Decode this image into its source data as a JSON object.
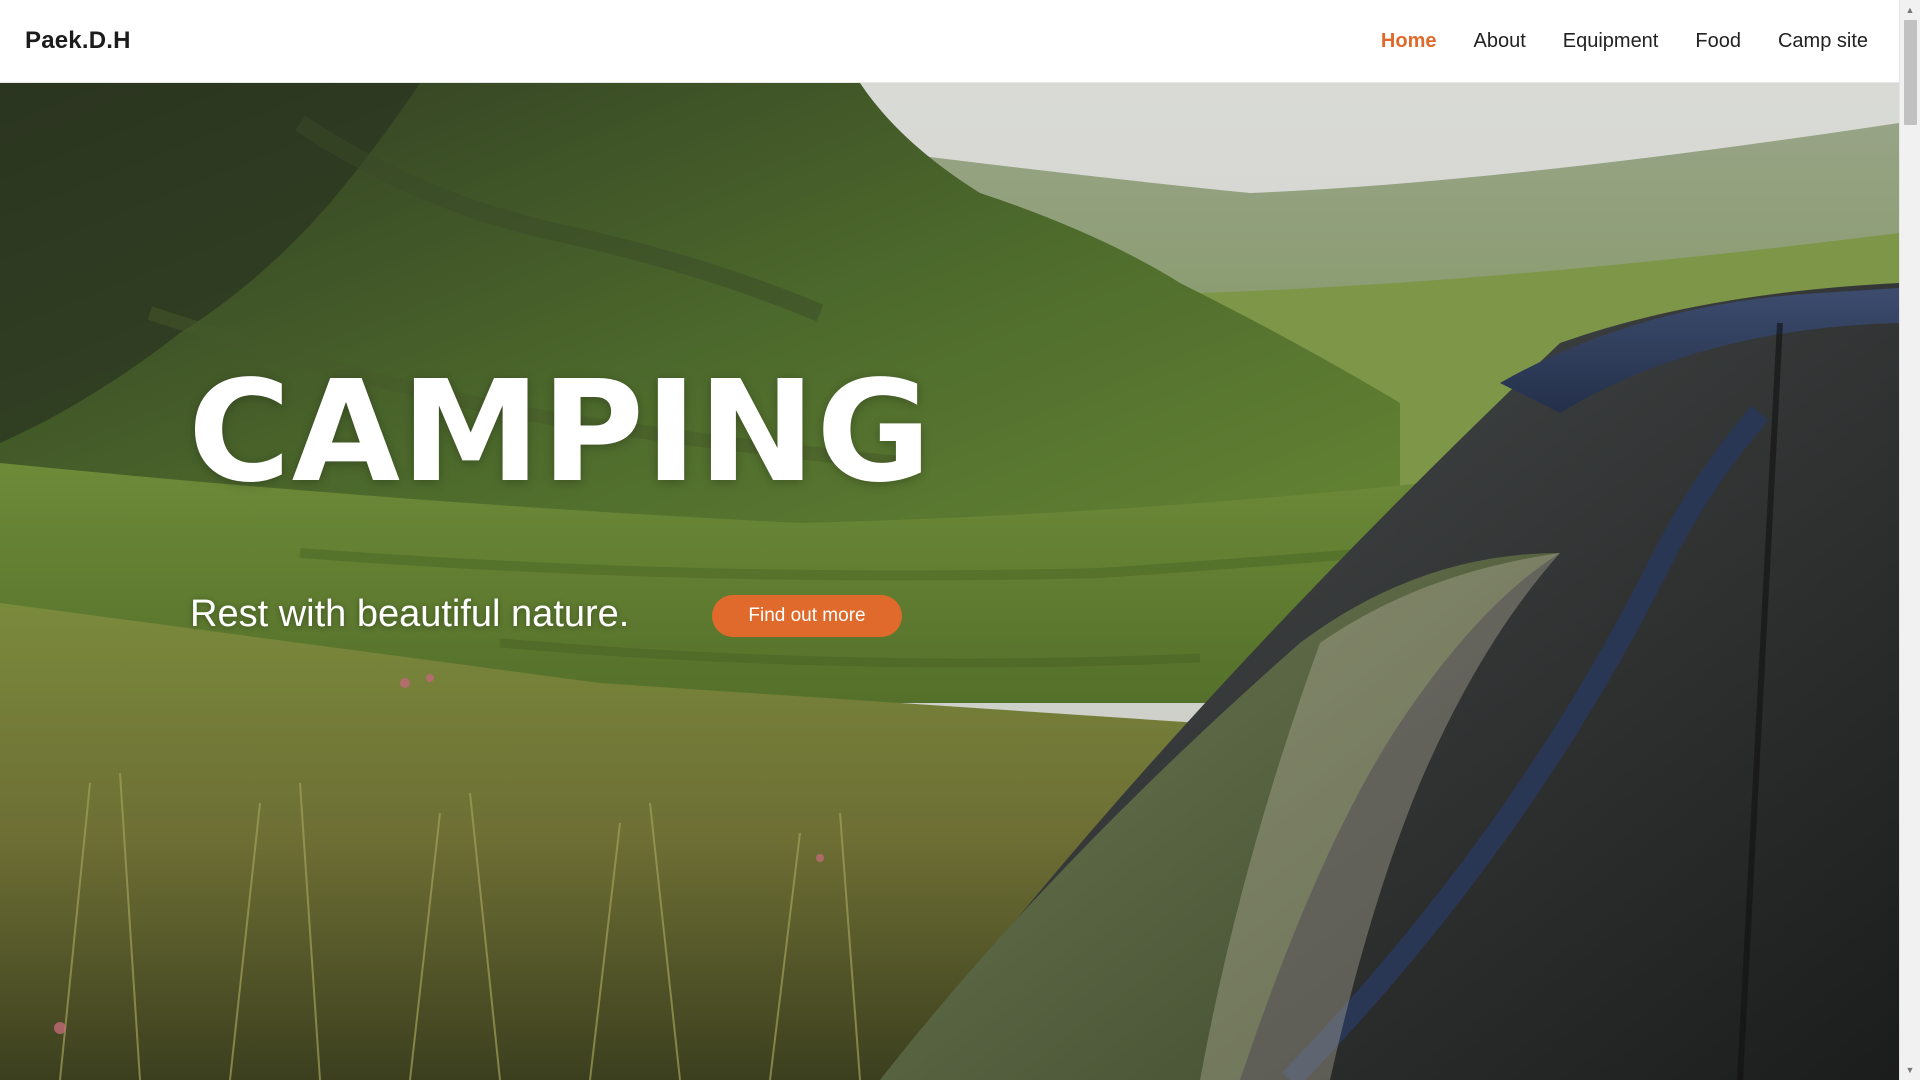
{
  "header": {
    "logo": "Paek.D.H",
    "nav": [
      {
        "label": "Home",
        "active": true
      },
      {
        "label": "About",
        "active": false
      },
      {
        "label": "Equipment",
        "active": false
      },
      {
        "label": "Food",
        "active": false
      },
      {
        "label": "Camp site",
        "active": false
      }
    ]
  },
  "hero": {
    "title": "CAMPING",
    "subtitle": "Rest with beautiful nature.",
    "cta_label": "Find out more",
    "background_image": "mountain-valley-tent-photo"
  },
  "colors": {
    "accent": "#e06a2c",
    "text_dark": "#222222",
    "header_bg": "#ffffff"
  }
}
